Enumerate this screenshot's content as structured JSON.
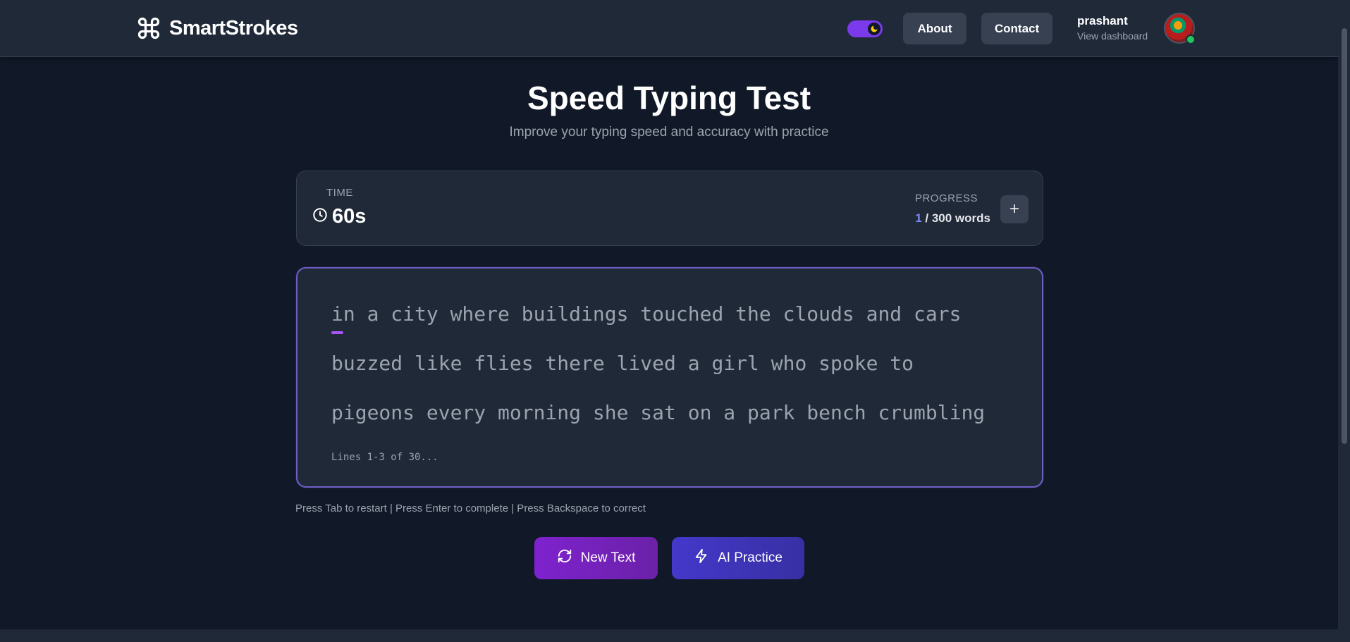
{
  "header": {
    "brand": "SmartStrokes",
    "nav": {
      "about": "About",
      "contact": "Contact"
    },
    "theme_toggle": {
      "state": "dark",
      "icon": "moon-icon"
    },
    "user": {
      "name": "prashant",
      "link": "View dashboard",
      "status": "online"
    }
  },
  "page": {
    "title": "Speed Typing Test",
    "subtitle": "Improve your typing speed and accuracy with practice"
  },
  "stats": {
    "time_label": "TIME",
    "time_value": "60s",
    "progress_label": "PROGRESS",
    "progress_current": "1",
    "progress_total": " / 300 words",
    "add_button": "+"
  },
  "typing": {
    "lines": [
      "in a city where buildings touched the clouds and cars",
      "buzzed like flies there lived a girl who spoke to",
      "pigeons every morning she sat on a park bench crumbling"
    ],
    "lines_info": "Lines 1-3 of 30..."
  },
  "hint": "Press Tab to restart | Press Enter to complete | Press Backspace to correct",
  "actions": {
    "new_text": "New Text",
    "ai_practice": "AI Practice"
  },
  "colors": {
    "accent": "#7c3aed",
    "background": "#111827",
    "card": "#1f2937",
    "progress_highlight": "#818cf8"
  }
}
